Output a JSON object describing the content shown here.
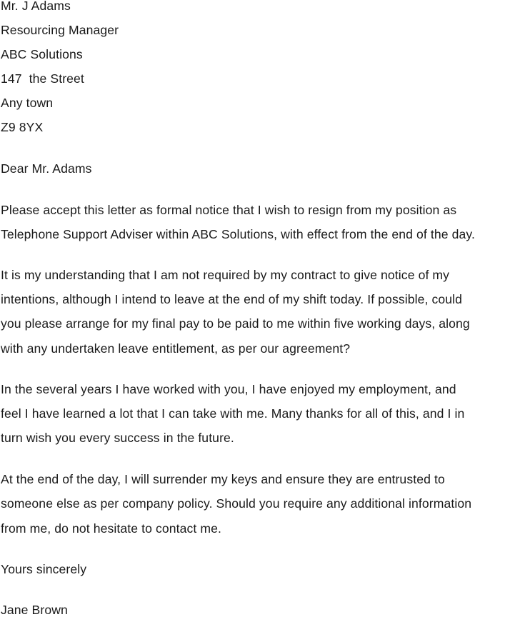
{
  "recipient": {
    "name": "Mr. J Adams",
    "title": "Resourcing Manager",
    "company": "ABC Solutions",
    "street": "147  the Street",
    "town": "Any town",
    "postcode": "Z9 8YX"
  },
  "salutation": "Dear Mr. Adams",
  "paragraphs": [
    {
      "lines": [
        "Please accept this letter as formal notice that I wish to resign from my position as",
        "Telephone Support Adviser within ABC Solutions, with effect from the end of the day."
      ]
    },
    {
      "lines": [
        "It is my understanding that I am not required by my contract to give notice of my",
        "intentions, although I intend to leave at the end of my shift today. If possible, could",
        "you please arrange for my final pay to be paid to me within five working days, along",
        "with any undertaken leave entitlement, as per our agreement?"
      ]
    },
    {
      "lines": [
        "In the several years I have worked with you, I have enjoyed my employment, and",
        "feel I have learned a lot that I can take with me. Many thanks for all of this, and I in",
        "turn wish you every success in the future."
      ]
    },
    {
      "lines": [
        "At the end of the day, I will surrender my keys and ensure they are entrusted to",
        "someone else as per company policy. Should you require any additional information",
        "from me, do not hesitate to contact me."
      ]
    }
  ],
  "closing": "Yours sincerely",
  "signature": "Jane Brown"
}
